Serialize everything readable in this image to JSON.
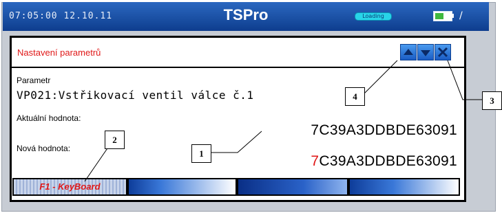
{
  "statusbar": {
    "datetime": "07:05:00 12.10.11",
    "app_title": "TSPro",
    "badge": "Loading",
    "colors": {
      "bar": "#1a4ea0",
      "battery": "#3fb83f"
    }
  },
  "dialog": {
    "title": "Nastavení parametrů",
    "buttons": {
      "up": "arrow-up-icon",
      "down": "arrow-down-icon",
      "close": "close-icon"
    },
    "parameter_label": "Parametr",
    "parameter_value": "VP021:Vstřikovací ventil válce č.1",
    "current_label": "Aktuální hodnota:",
    "current_value": "7C39A3DDBDE63091",
    "new_label": "Nová hodnota:",
    "new_value_first": "7",
    "new_value_rest": "C39A3DDBDE63091"
  },
  "softkeys": {
    "f1_label": "F1 - KeyBoard"
  },
  "callouts": {
    "c1": "1",
    "c2": "2",
    "c3": "3",
    "c4": "4"
  }
}
